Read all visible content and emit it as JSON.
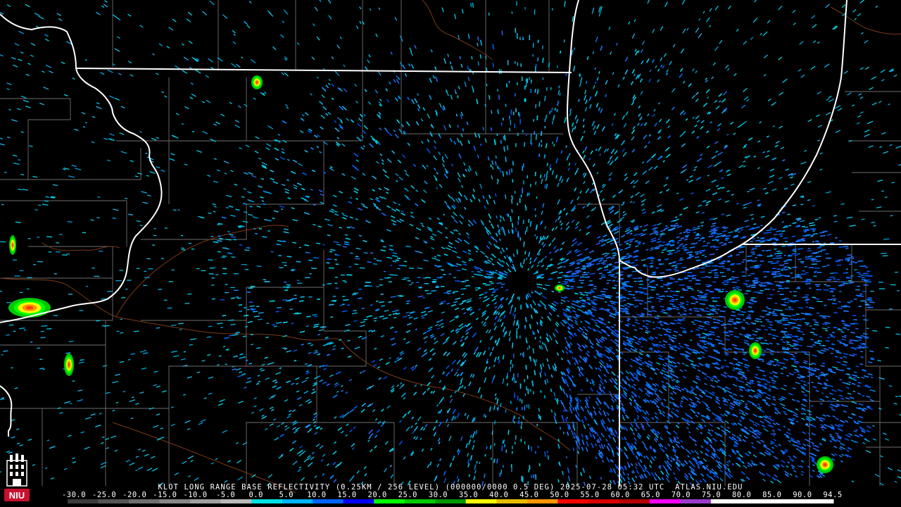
{
  "product": {
    "header": "KLOT LONG RANGE BASE REFLECTIVITY (0.25KM / 256 LEVEL) (000000/0000 0.5 DEG) 2025-07-28 05:32 UTC  ATLAS.NIU.EDU"
  },
  "logo": {
    "text": "NIU",
    "icon": "university-tower-icon"
  },
  "colorbar": {
    "labels": [
      "-30.0",
      "-25.0",
      "-20.0",
      "-15.0",
      "-10.0",
      "-5.0",
      "0.0",
      "5.0",
      "10.0",
      "15.0",
      "20.0",
      "25.0",
      "30.0",
      "35.0",
      "40.0",
      "45.0",
      "50.0",
      "55.0",
      "60.0",
      "65.0",
      "70.0",
      "75.0",
      "80.0",
      "85.0",
      "90.0",
      "94.5"
    ],
    "colors": [
      "#3c3c3c",
      "#555555",
      "#6e6e6e",
      "#878787",
      "#a0a0a0",
      "#b9b9b9",
      "#00e1e1",
      "#00b4ff",
      "#0064ff",
      "#0000ff",
      "#00ff00",
      "#00c800",
      "#009600",
      "#ffff00",
      "#e6bc00",
      "#ff9600",
      "#ff0000",
      "#d60000",
      "#b40000",
      "#ff00ff",
      "#9b3ccb",
      "#ffffff",
      "#ffffff",
      "#ffffff",
      "#ffffff"
    ]
  },
  "map_colors": {
    "state_border": "#ffffff",
    "county_border": "#6e6e6e",
    "river": "#7a3a18",
    "background": "#000000"
  },
  "storm_cells": [
    {
      "name": "north-cell",
      "intensity": "light-moderate"
    },
    {
      "name": "west-cell-1",
      "intensity": "moderate"
    },
    {
      "name": "west-cell-2",
      "intensity": "moderate"
    },
    {
      "name": "west-cell-3",
      "intensity": "moderate"
    },
    {
      "name": "east-cell-1",
      "intensity": "moderate"
    },
    {
      "name": "east-cell-2",
      "intensity": "moderate"
    },
    {
      "name": "southeast-cell",
      "intensity": "moderate"
    }
  ]
}
